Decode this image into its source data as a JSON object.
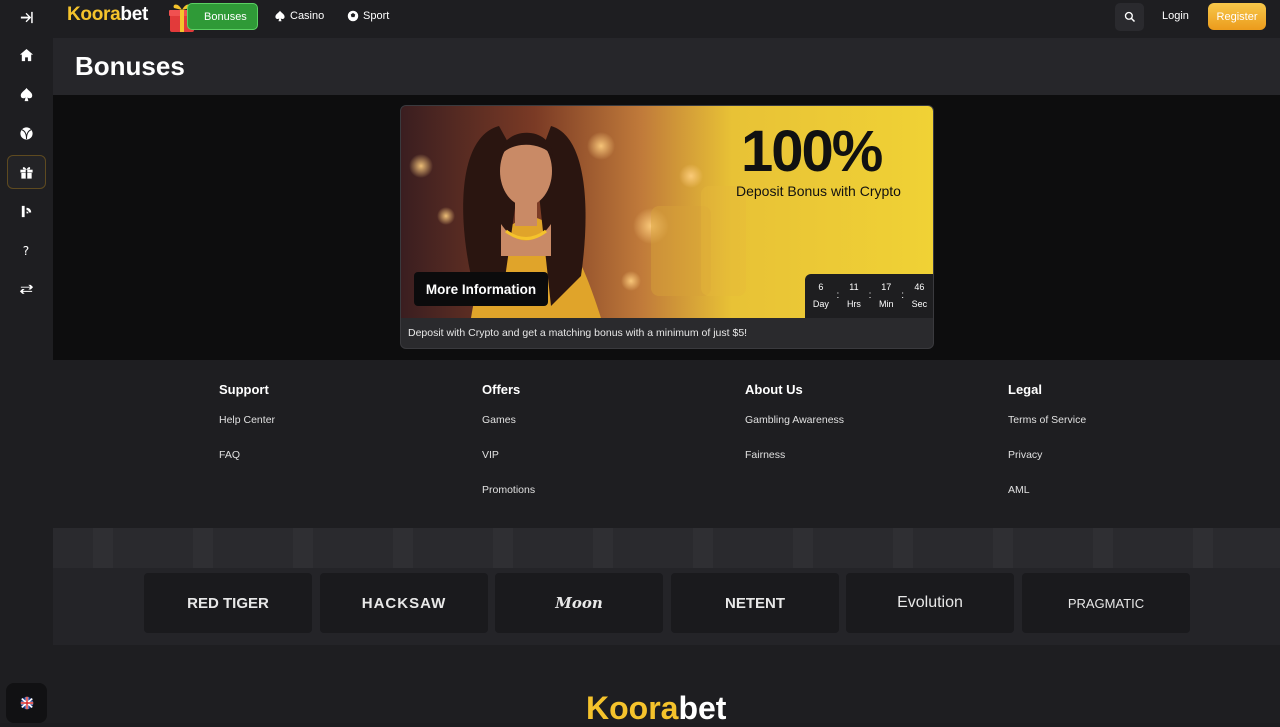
{
  "header": {
    "logo_part1": "Koora",
    "logo_part2": "bet",
    "nav": {
      "bonuses": "Bonuses",
      "casino": "Casino",
      "sport": "Sport"
    },
    "login": "Login",
    "register": "Register"
  },
  "sidebar": {
    "icons": [
      "collapse-icon",
      "home-icon",
      "spade-icon",
      "sports-ball-icon",
      "gift-icon",
      "affiliate-icon",
      "help-icon",
      "exchange-icon"
    ],
    "language_flag": "uk-flag-icon"
  },
  "page": {
    "title": "Bonuses"
  },
  "promo": {
    "headline": "100%",
    "subheadline": "Deposit Bonus with Crypto",
    "button": "More Information",
    "description": "Deposit with Crypto and get a matching bonus with a minimum of just $5!",
    "timer": [
      {
        "value": "6",
        "unit": "Day"
      },
      {
        "value": "11",
        "unit": "Hrs"
      },
      {
        "value": "17",
        "unit": "Min"
      },
      {
        "value": "46",
        "unit": "Sec"
      }
    ]
  },
  "footer": {
    "columns": [
      {
        "heading": "Support",
        "links": [
          "Help Center",
          "FAQ"
        ]
      },
      {
        "heading": "Offers",
        "links": [
          "Games",
          "VIP",
          "Promotions"
        ]
      },
      {
        "heading": "About Us",
        "links": [
          "Gambling Awareness",
          "Fairness"
        ]
      },
      {
        "heading": "Legal",
        "links": [
          "Terms of Service",
          "Privacy",
          "AML"
        ]
      }
    ],
    "providers": [
      "RED TIGER",
      "HACKSAW",
      "Moon",
      "NETENT",
      "Evolution",
      "PRAGMATIC"
    ],
    "bottom_logo_part1": "Koora",
    "bottom_logo_part2": "bet"
  },
  "colors": {
    "accent": "#f5c32c",
    "bonus_green": "#2f9a37",
    "register_orange": "#ec9b1c",
    "background": "#1c1c1f"
  }
}
